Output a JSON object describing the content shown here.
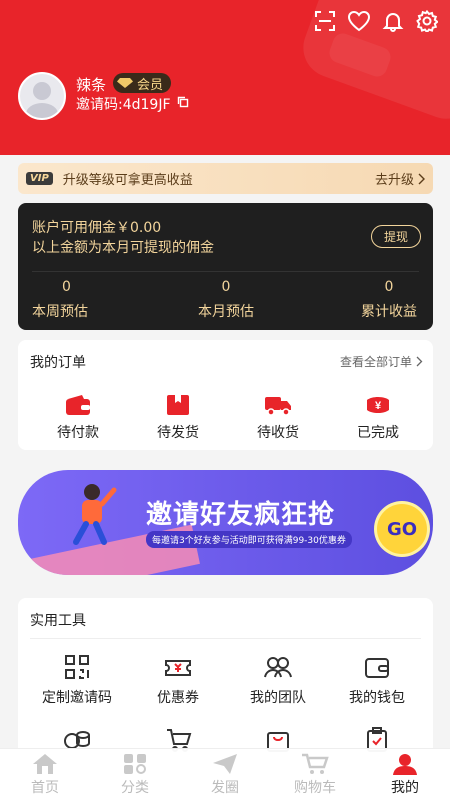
{
  "user": {
    "name": "辣条",
    "badge": "会员",
    "invite_label": "邀请码:4d19JF"
  },
  "vip": {
    "tag": "VIP",
    "text": "升级等级可拿更高收益",
    "link": "去升级"
  },
  "wallet": {
    "line1": "账户可用佣金￥0.00",
    "line2": "以上金额为本月可提现的佣金",
    "withdraw": "提现",
    "stats": [
      {
        "value": "0",
        "label": "本周预估"
      },
      {
        "value": "0",
        "label": "本月预估"
      },
      {
        "value": "0",
        "label": "累计收益"
      }
    ]
  },
  "orders": {
    "title": "我的订单",
    "view_all": "查看全部订单",
    "items": [
      {
        "label": "待付款",
        "icon": "wallet-icon"
      },
      {
        "label": "待发货",
        "icon": "box-icon"
      },
      {
        "label": "待收货",
        "icon": "truck-icon"
      },
      {
        "label": "已完成",
        "icon": "coin-icon"
      }
    ]
  },
  "banner": {
    "title": "邀请好友疯狂抢",
    "subtitle": "每邀请3个好友参与活动即可获得满99-30优惠券",
    "go": "GO"
  },
  "tools": {
    "title": "实用工具",
    "items": [
      {
        "label": "定制邀请码",
        "icon": "qrcode-icon"
      },
      {
        "label": "优惠券",
        "icon": "coupon-icon"
      },
      {
        "label": "我的团队",
        "icon": "team-icon"
      },
      {
        "label": "我的钱包",
        "icon": "purse-icon"
      }
    ]
  },
  "tabbar": [
    {
      "label": "首页",
      "icon": "home-icon"
    },
    {
      "label": "分类",
      "icon": "category-icon"
    },
    {
      "label": "发圈",
      "icon": "send-icon"
    },
    {
      "label": "购物车",
      "icon": "cart-icon"
    },
    {
      "label": "我的",
      "icon": "person-icon",
      "active": true
    }
  ],
  "colors": {
    "brand_red": "#e8242a",
    "gold": "#f3d59c",
    "dark_card": "#1f1f1f"
  }
}
